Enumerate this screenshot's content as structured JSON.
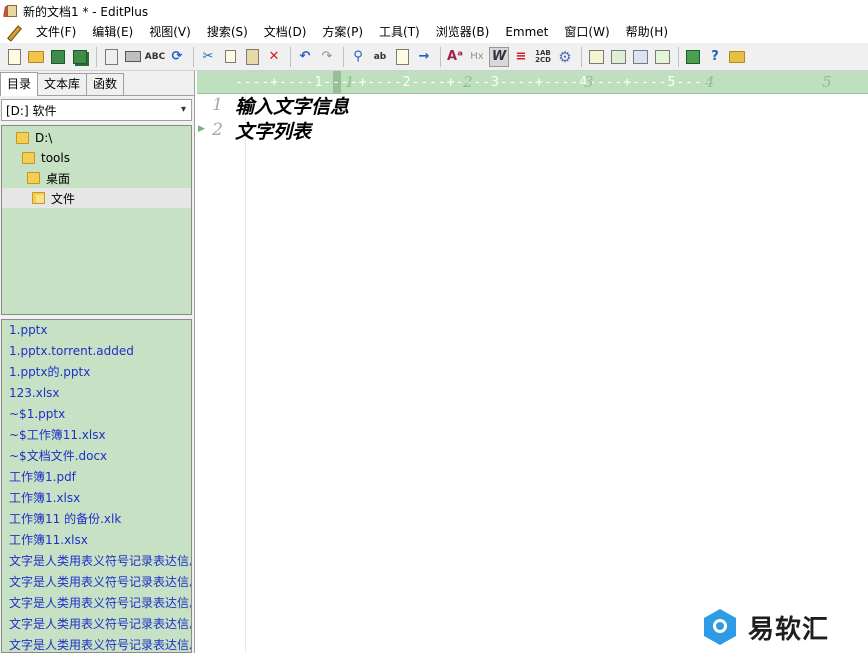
{
  "window": {
    "title": "新的文档1 * - EditPlus"
  },
  "menu": {
    "items": [
      "文件(F)",
      "编辑(E)",
      "视图(V)",
      "搜索(S)",
      "文档(D)",
      "方案(P)",
      "工具(T)",
      "浏览器(B)",
      "Emmet",
      "窗口(W)",
      "帮助(H)"
    ]
  },
  "toolbar": {
    "icons": [
      "new-file",
      "open-folder",
      "save",
      "save-all",
      "print-preview",
      "print",
      "spell-check",
      "browser-preview",
      "cut",
      "copy",
      "paste",
      "delete",
      "undo",
      "redo",
      "find",
      "replace",
      "find-in-files",
      "goto-line",
      "font",
      "hex",
      "word-wrap",
      "line-number",
      "column-select",
      "settings",
      "directory",
      "cliptext",
      "output",
      "user-tool",
      "ftp-upload",
      "help",
      "html-toolbar"
    ],
    "labels": {
      "spell": "ABC",
      "font": "Aᵃ",
      "hex": "Hx",
      "wrap": "W",
      "col": "1AB\n2CD"
    }
  },
  "left_panel": {
    "tabs": [
      "目录",
      "文本库",
      "函数"
    ],
    "active_tab": 0,
    "drive": "[D:] 软件",
    "tree": [
      {
        "label": "D:\\",
        "level": 0
      },
      {
        "label": "tools",
        "level": 1
      },
      {
        "label": "桌面",
        "level": 2
      },
      {
        "label": "文件",
        "level": 3,
        "selected": true
      }
    ],
    "files": [
      "1.pptx",
      "1.pptx.torrent.added",
      "1.pptx的.pptx",
      "123.xlsx",
      "~$1.pptx",
      "~$工作簿11.xlsx",
      "~$文档文件.docx",
      "工作簿1.pdf",
      "工作簿1.xlsx",
      "工作簿11 的备份.xlk",
      "工作簿11.xlsx",
      "文字是人类用表义符号记录表达信息",
      "文字是人类用表义符号记录表达信息",
      "文字是人类用表义符号记录表达信息",
      "文字是人类用表义符号记录表达信息",
      "文字是人类用表义符号记录表达信息"
    ]
  },
  "editor": {
    "ruler": {
      "dashes": "----+----1----+----2----+----3----+----4----+----5----",
      "numbers": [
        "1",
        "2",
        "3",
        "4",
        "5"
      ]
    },
    "lines": [
      {
        "no": "1",
        "text": "输入文字信息"
      },
      {
        "no": "2",
        "text": "文字列表"
      }
    ]
  },
  "watermark": {
    "text": "易软汇"
  },
  "colors": {
    "panel_green": "#c7e1c5",
    "file_link": "#1f2fc8",
    "ruler_green": "#bfe0bf"
  }
}
